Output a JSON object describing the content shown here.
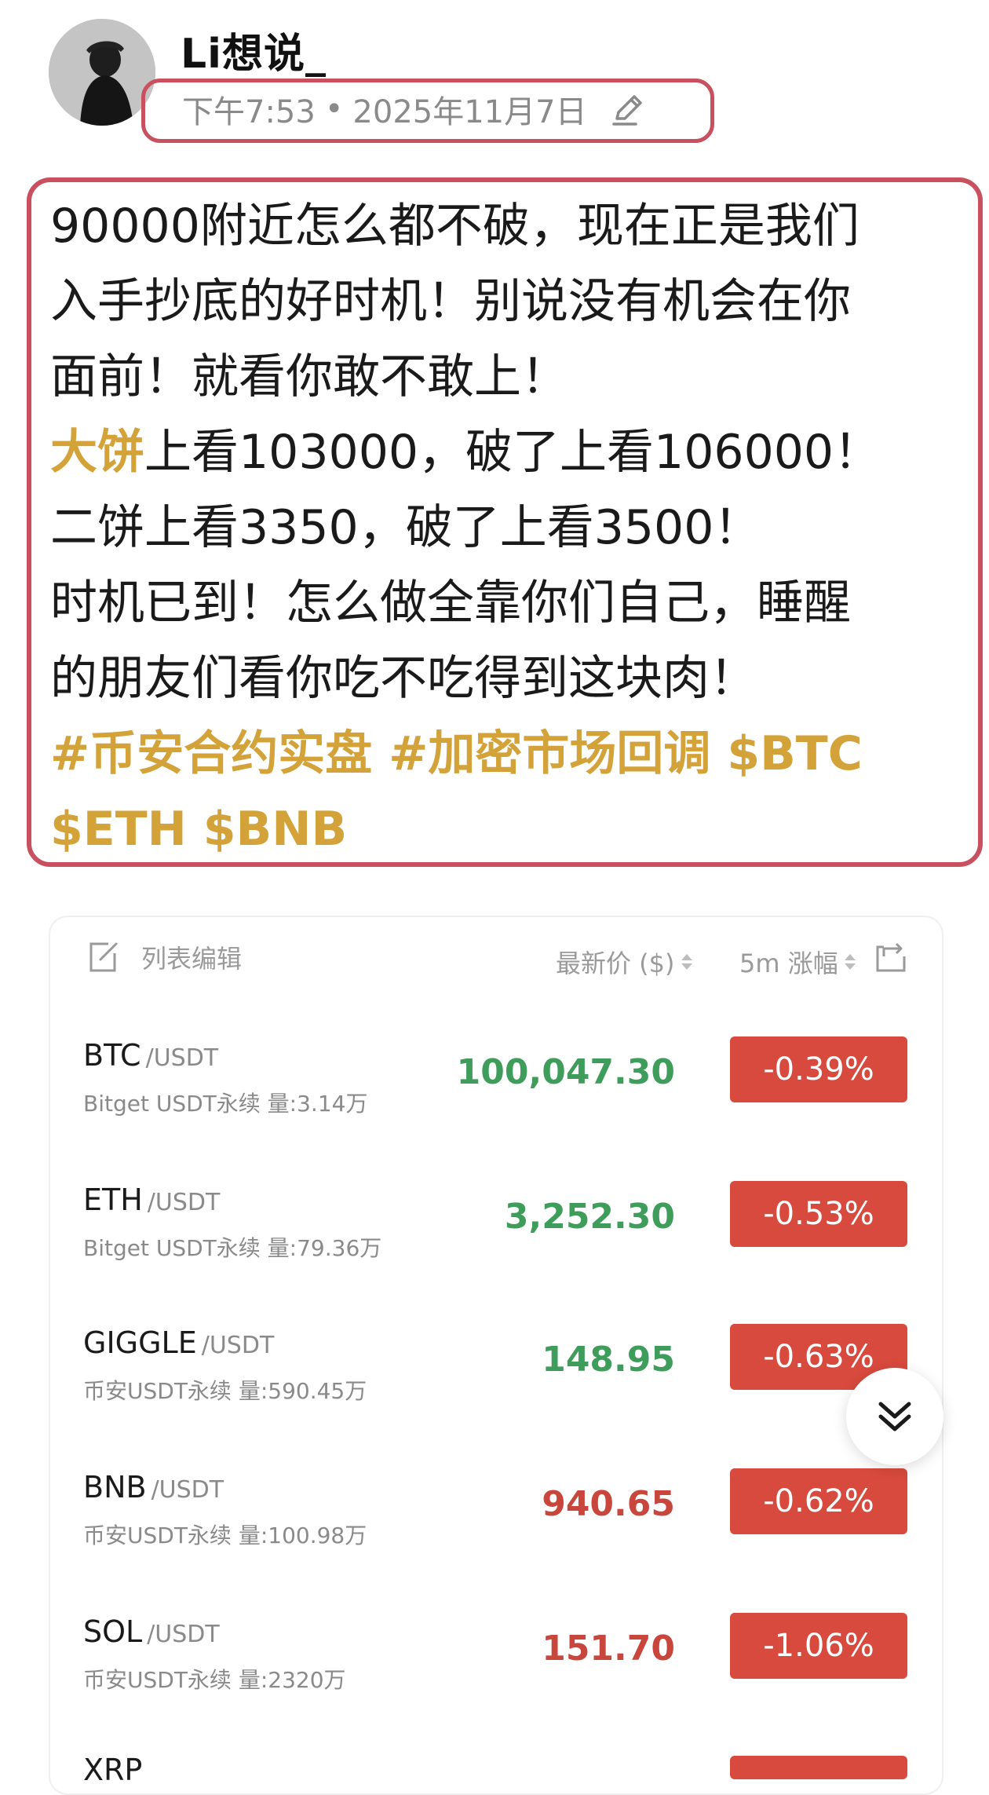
{
  "post": {
    "username": "Li想说_",
    "time": "下午7:53",
    "separator": "•",
    "date": "2025年11月7日",
    "lines": [
      "90000附近怎么都不破，现在正是我们",
      "入手抄底的好时机！别说没有机会在你",
      "面前！就看你敢不敢上！"
    ],
    "line4_highlight": "大饼",
    "line4_rest": "上看103000，破了上看106000！",
    "line5": "二饼上看3350，破了上看3500！",
    "line6": "时机已到！怎么做全靠你们自己，睡醒",
    "line7": "的朋友们看你吃不吃得到这块肉！",
    "tags_line1": "#币安合约实盘 #加密市场回调 $BTC",
    "tags_line2": "$ETH $BNB",
    "highlight_color": "#d3a33a"
  },
  "market": {
    "edit_label": "列表编辑",
    "price_header": "最新价 ($)",
    "change_header": "5m 涨幅",
    "rows": [
      {
        "symbol": "BTC",
        "quote": "/USDT",
        "sub": "Bitget USDT永续 量:3.14万",
        "price": "100,047.30",
        "change": "-0.39%",
        "trend": "up"
      },
      {
        "symbol": "ETH",
        "quote": "/USDT",
        "sub": "Bitget USDT永续 量:79.36万",
        "price": "3,252.30",
        "change": "-0.53%",
        "trend": "up"
      },
      {
        "symbol": "GIGGLE",
        "quote": "/USDT",
        "sub": "币安USDT永续 量:590.45万",
        "price": "148.95",
        "change": "-0.63%",
        "trend": "up"
      },
      {
        "symbol": "BNB",
        "quote": "/USDT",
        "sub": "币安USDT永续 量:100.98万",
        "price": "940.65",
        "change": "-0.62%",
        "trend": "down"
      },
      {
        "symbol": "SOL",
        "quote": "/USDT",
        "sub": "币安USDT永续 量:2320万",
        "price": "151.70",
        "change": "-1.06%",
        "trend": "down"
      }
    ],
    "partial_symbol": "XRP",
    "colors": {
      "up": "#3f9d5b",
      "down": "#c8463c",
      "badge": "#d84a3d"
    }
  }
}
